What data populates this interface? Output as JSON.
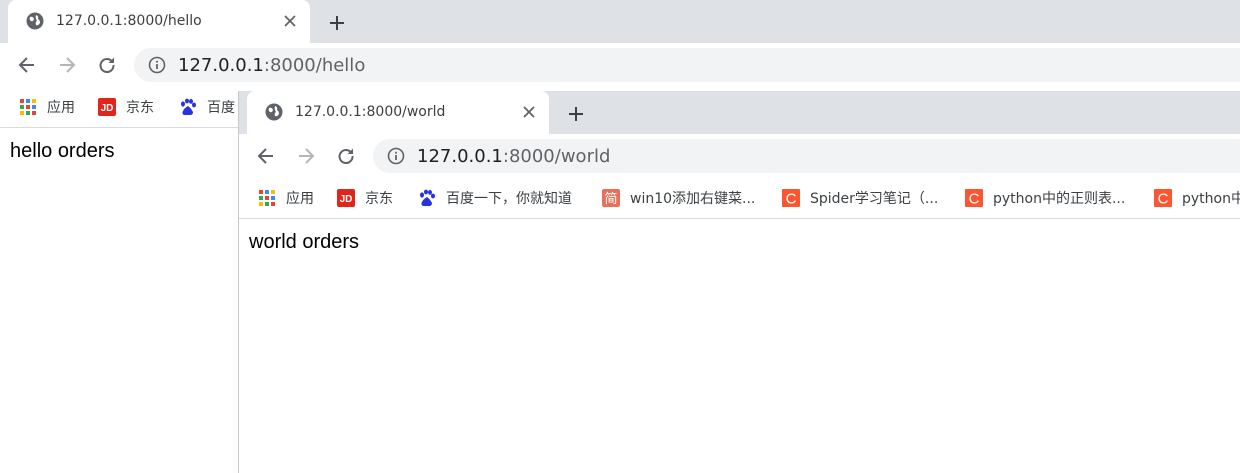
{
  "window1": {
    "tab": {
      "title": "127.0.0.1:8000/hello"
    },
    "url": {
      "host": "127.0.0.1",
      "path": ":8000/hello"
    },
    "bookmarks": [
      {
        "label": "应用",
        "icon": "apps-grid-icon"
      },
      {
        "label": "京东",
        "icon": "jd-icon"
      },
      {
        "label": "百度",
        "icon": "baidu-paw-icon"
      }
    ],
    "page": {
      "text": "hello orders"
    }
  },
  "window2": {
    "tab": {
      "title": "127.0.0.1:8000/world"
    },
    "url": {
      "host": "127.0.0.1",
      "path": ":8000/world"
    },
    "bookmarks": [
      {
        "label": "应用",
        "icon": "apps-grid-icon"
      },
      {
        "label": "京东",
        "icon": "jd-icon"
      },
      {
        "label": "百度一下，你就知道",
        "icon": "baidu-paw-icon"
      },
      {
        "label": "win10添加右键菜...",
        "icon": "jianshu-icon"
      },
      {
        "label": "Spider学习笔记（...",
        "icon": "csdn-icon"
      },
      {
        "label": "python中的正则表...",
        "icon": "csdn-icon"
      },
      {
        "label": "python中",
        "icon": "csdn-icon"
      }
    ],
    "page": {
      "text": "world orders"
    }
  },
  "colors": {
    "tabstrip": "#dee1e6",
    "omnibox": "#f1f3f4",
    "jd": "#e1251b",
    "baidu": "#2932e1",
    "csdn": "#fc5531",
    "jianshu": "#ea6f5a"
  }
}
